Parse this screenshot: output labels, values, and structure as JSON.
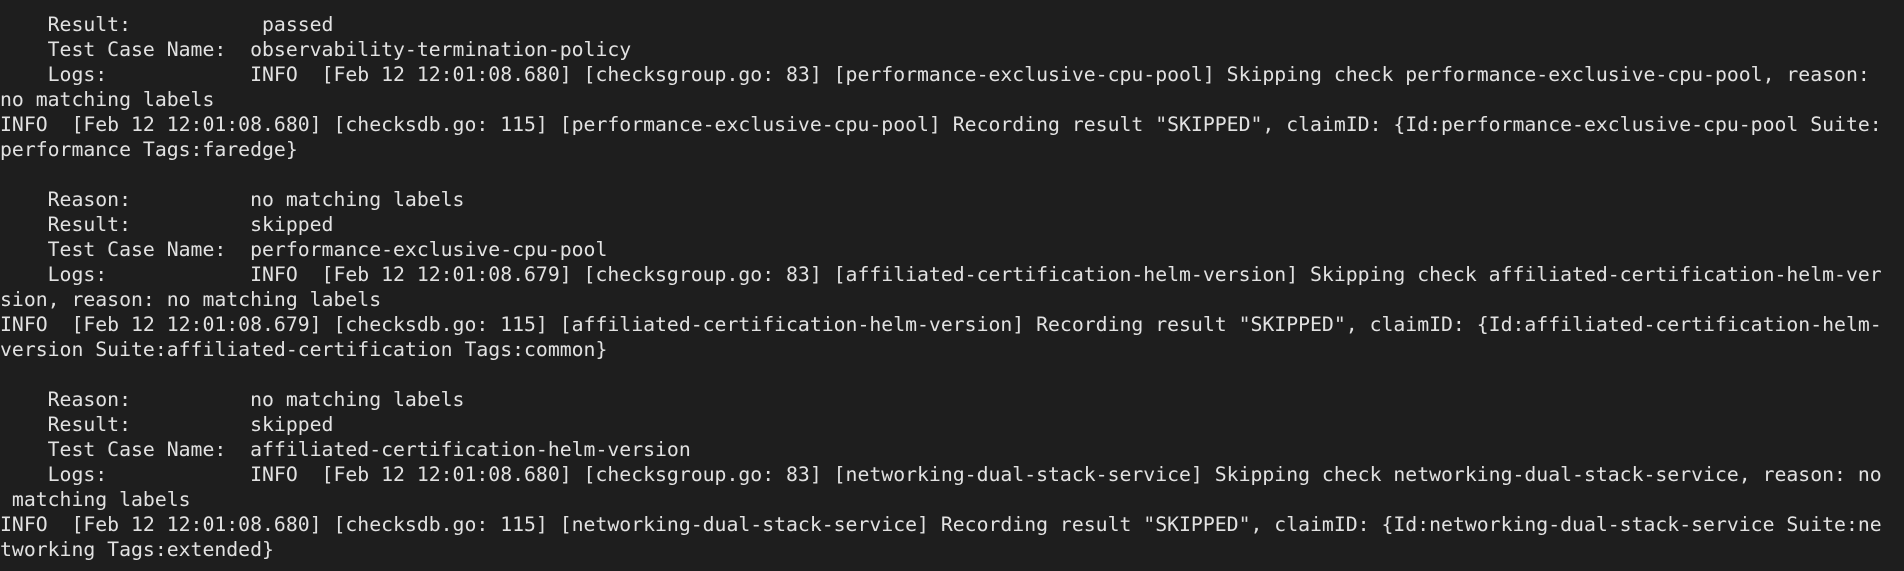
{
  "terminal": {
    "lines": [
      "    Result:           passed",
      "    Test Case Name:  observability-termination-policy",
      "    Logs:            INFO  [Feb 12 12:01:08.680] [checksgroup.go: 83] [performance-exclusive-cpu-pool] Skipping check performance-exclusive-cpu-pool, reason:",
      "no matching labels",
      "INFO  [Feb 12 12:01:08.680] [checksdb.go: 115] [performance-exclusive-cpu-pool] Recording result \"SKIPPED\", claimID: {Id:performance-exclusive-cpu-pool Suite:",
      "performance Tags:faredge}",
      "",
      "    Reason:          no matching labels",
      "    Result:          skipped",
      "    Test Case Name:  performance-exclusive-cpu-pool",
      "    Logs:            INFO  [Feb 12 12:01:08.679] [checksgroup.go: 83] [affiliated-certification-helm-version] Skipping check affiliated-certification-helm-ver",
      "sion, reason: no matching labels",
      "INFO  [Feb 12 12:01:08.679] [checksdb.go: 115] [affiliated-certification-helm-version] Recording result \"SKIPPED\", claimID: {Id:affiliated-certification-helm-",
      "version Suite:affiliated-certification Tags:common}",
      "",
      "    Reason:          no matching labels",
      "    Result:          skipped",
      "    Test Case Name:  affiliated-certification-helm-version",
      "    Logs:            INFO  [Feb 12 12:01:08.680] [checksgroup.go: 83] [networking-dual-stack-service] Skipping check networking-dual-stack-service, reason: no",
      " matching labels",
      "INFO  [Feb 12 12:01:08.680] [checksdb.go: 115] [networking-dual-stack-service] Recording result \"SKIPPED\", claimID: {Id:networking-dual-stack-service Suite:ne",
      "tworking Tags:extended}"
    ]
  }
}
